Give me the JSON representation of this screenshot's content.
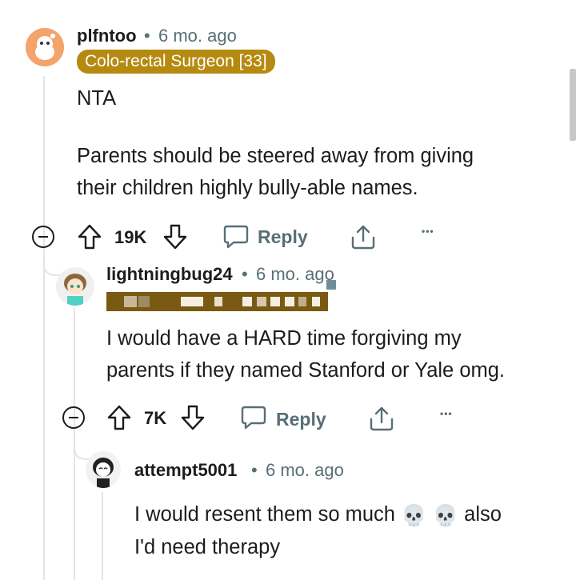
{
  "comments": [
    {
      "username": "plfntoo",
      "separator": "•",
      "time": "6 mo. ago",
      "flair": "Colo-rectal Surgeon [33]",
      "body_line1": "NTA",
      "body_line2": "Parents should be steered away from giving",
      "body_line3": "their children highly bully-able names.",
      "votes": "19K",
      "reply_label": "Reply",
      "more_label": "•••"
    },
    {
      "username": "lightningbug24",
      "separator": "•",
      "time": "6 mo. ago",
      "body_line1": "I would have a HARD time forgiving my",
      "body_line2": "parents if they named Stanford or Yale omg.",
      "votes": "7K",
      "reply_label": "Reply",
      "more_label": "•••"
    },
    {
      "username": "attempt5001",
      "separator": "•",
      "time": "6 mo. ago",
      "body_line1_pre": "I would resent them so much",
      "body_line1_emoji": "💀 💀",
      "body_line1_post": "also",
      "body_line2": "I'd need therapy"
    }
  ],
  "colors": {
    "flair_bg": "#b58a10",
    "meta_text": "#576f76",
    "censor_bar": "#7a5a12"
  }
}
